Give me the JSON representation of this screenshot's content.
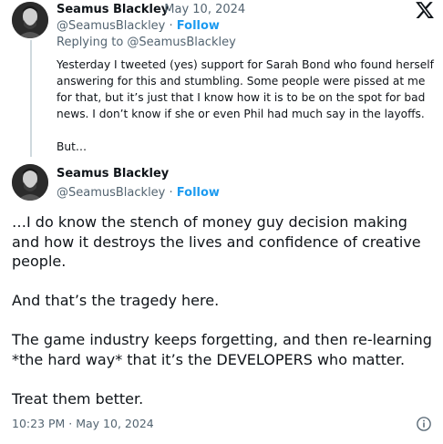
{
  "reply_tweet": {
    "author_name": "Seamus Blackley",
    "date": "May 10, 2024",
    "handle": "@SeamusBlackley",
    "follow_label": "Follow",
    "replying_to": "Replying to @SeamusBlackley",
    "paragraphs": [
      "Yesterday I tweeted (yes) support for Sarah Bond who found herself answering for this and stumbling. Some people were pissed at me for that, but it’s just that I know how it is to be on the spot for bad news. I don’t know if she or even Phil had much say in the layoffs.",
      "But…"
    ]
  },
  "main_tweet": {
    "author_name": "Seamus Blackley",
    "handle": "@SeamusBlackley",
    "follow_label": "Follow",
    "paragraphs": [
      "…I do know the stench of money guy decision making and how it destroys the lives and confidence of creative people.",
      "And that’s the tragedy here.",
      "The game industry keeps forgetting, and  then re-learning *the hard way* that it’s the DEVELOPERS who matter.",
      "Treat them better."
    ],
    "timestamp": "10:23 PM · May 10, 2024"
  },
  "icons": {
    "logo": "x-logo-icon",
    "info": "info-icon"
  },
  "colors": {
    "link": "#1d9bf0",
    "secondary": "#536471",
    "text": "#0f1419",
    "thread_line": "#cfd9de"
  }
}
